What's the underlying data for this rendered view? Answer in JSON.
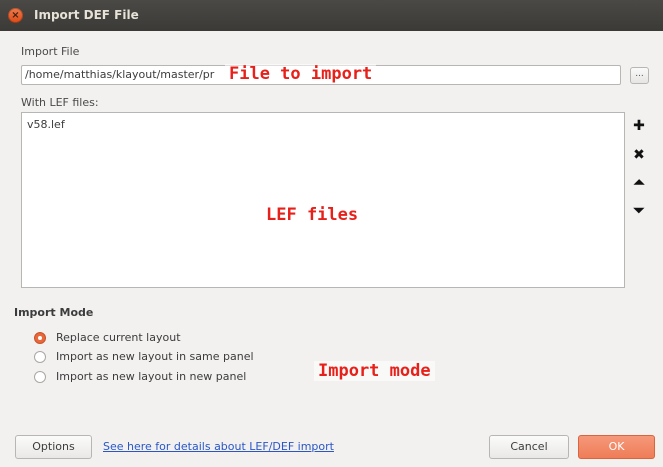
{
  "window": {
    "title": "Import DEF File",
    "close_glyph": "×"
  },
  "import_file": {
    "label": "Import File",
    "value": "/home/matthias/klayout/master/pr",
    "browse_label": "..."
  },
  "lef_files": {
    "label": "With LEF files:",
    "items": [
      "v58.lef"
    ],
    "buttons": {
      "add_glyph": "✚",
      "remove_glyph": "✖",
      "move_up_glyph": "⏶",
      "move_down_glyph": "⏷"
    }
  },
  "import_mode": {
    "title": "Import Mode",
    "options": [
      {
        "label": "Replace current layout",
        "checked": true
      },
      {
        "label": "Import as new layout in same panel",
        "checked": false
      },
      {
        "label": "Import as new layout in new panel",
        "checked": false
      }
    ]
  },
  "annotations": {
    "file": "File to import",
    "lef": "LEF files",
    "mode": "Import mode"
  },
  "footer": {
    "options_label": "Options",
    "help_link": "See here for details about LEF/DEF import",
    "cancel_label": "Cancel",
    "ok_label": "OK"
  },
  "colors": {
    "accent": "#ef7d58",
    "annotation": "#e8201a",
    "link": "#2a56c6"
  }
}
